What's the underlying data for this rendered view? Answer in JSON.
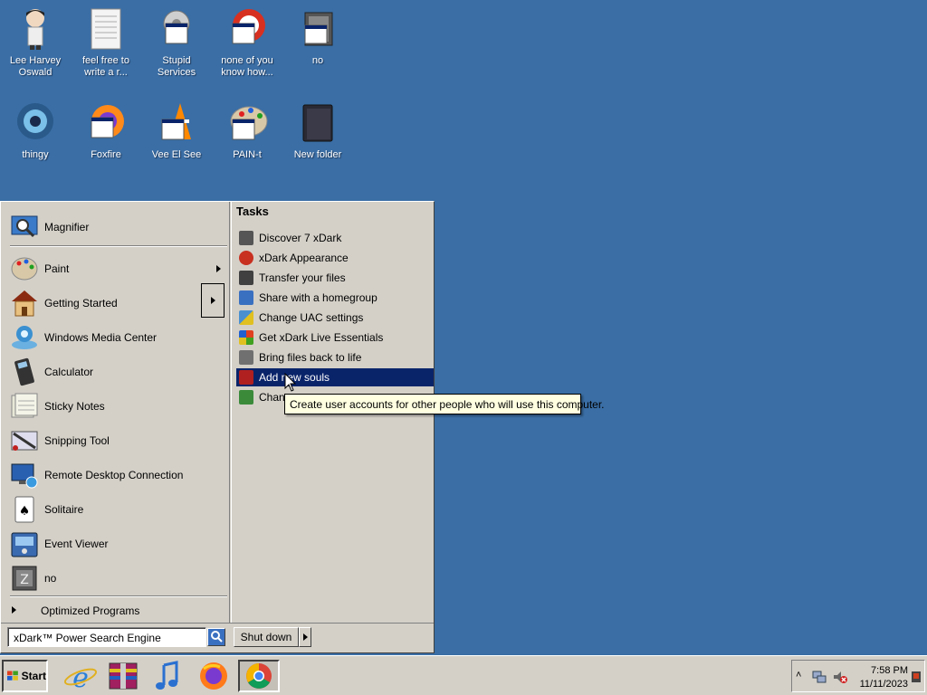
{
  "desktop": {
    "icons": [
      {
        "label": "Lee Harvey Oswald"
      },
      {
        "label": "feel free to write a r..."
      },
      {
        "label": "Stupid Services"
      },
      {
        "label": "none of you know how..."
      },
      {
        "label": "no"
      },
      {
        "label": "thingy"
      },
      {
        "label": "Foxfire"
      },
      {
        "label": "Vee El See"
      },
      {
        "label": "PAIN-t"
      },
      {
        "label": "New folder"
      }
    ]
  },
  "start_menu": {
    "programs": [
      {
        "label": "Magnifier",
        "icon": "magnifier-icon"
      },
      {
        "label": "Paint",
        "icon": "paint-icon"
      },
      {
        "label": "Getting Started",
        "icon": "getting-started-icon"
      },
      {
        "label": "Windows Media Center",
        "icon": "media-center-icon"
      },
      {
        "label": "Calculator",
        "icon": "calculator-icon"
      },
      {
        "label": "Sticky Notes",
        "icon": "sticky-notes-icon"
      },
      {
        "label": "Snipping Tool",
        "icon": "snipping-tool-icon"
      },
      {
        "label": "Remote Desktop Connection",
        "icon": "remote-desktop-icon"
      },
      {
        "label": "Solitaire",
        "icon": "solitaire-icon"
      },
      {
        "label": "Event Viewer",
        "icon": "event-viewer-icon"
      },
      {
        "label": "no",
        "icon": "box-icon"
      }
    ],
    "all_programs_label": "Optimized Programs",
    "tasks_title": "Tasks",
    "tasks": [
      {
        "label": "Discover 7 xDark",
        "color": "#555555"
      },
      {
        "label": "xDark Appearance",
        "color": "#c83020"
      },
      {
        "label": "Transfer your files",
        "color": "#404040"
      },
      {
        "label": "Share with a homegroup",
        "color": "#3a70c0"
      },
      {
        "label": "Change UAC settings",
        "color": "#4a90d0"
      },
      {
        "label": "Get xDark Live Essentials",
        "color": "#e0a020"
      },
      {
        "label": "Bring files back to life",
        "color": "#707070"
      },
      {
        "label": "Add new souls",
        "color": "#b02020"
      },
      {
        "label": "Chang",
        "color": "#3a8a3a"
      }
    ],
    "search_placeholder": "xDark™ Power Search Engine",
    "shutdown_label": "Shut down"
  },
  "tooltip": "Create user accounts for other people who will use this computer.",
  "taskbar": {
    "start_label": "Start",
    "time": "7:58 PM",
    "date": "11/11/2023"
  }
}
